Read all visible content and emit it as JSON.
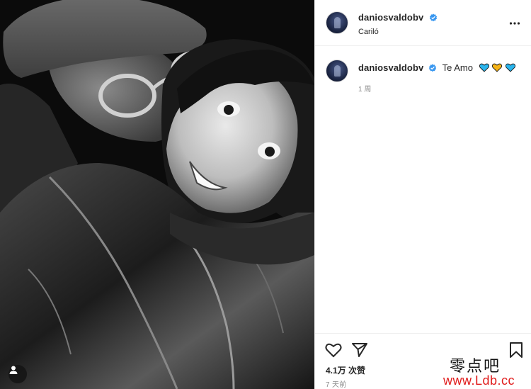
{
  "post": {
    "username": "daniosvaldobv",
    "location": "Cariló",
    "caption": {
      "username": "daniosvaldobv",
      "text": "Te Amo",
      "emojis": [
        "blue-heart",
        "yellow-heart",
        "blue-heart"
      ],
      "time": "1 周"
    },
    "likes": "4.1万 次赞",
    "date": "7 天前"
  },
  "watermark": {
    "line1": "零点吧",
    "line2": "www.Ldb.cc"
  },
  "colors": {
    "verified": "#3897f0",
    "blue_heart": "#2ab4ec",
    "yellow_heart": "#f5b318",
    "border": "#efefef",
    "muted_text": "#8e8e8e"
  }
}
